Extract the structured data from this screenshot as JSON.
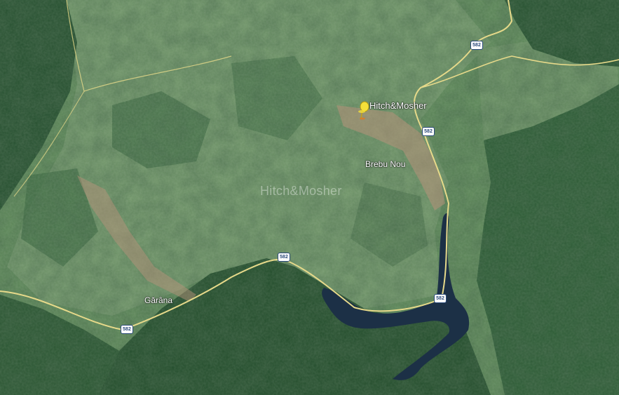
{
  "map": {
    "type": "satellite",
    "colors": {
      "forest": "#224d2c",
      "pasture": "#5f8a5a",
      "light_pasture": "#7f9f78",
      "lake": "#1c3046",
      "road": "#e6d98a",
      "village": "#b6927a",
      "pin": "#f4e03a"
    },
    "pin": {
      "label": "Hitch&Mosher",
      "icon": "yellow-pushpin-icon"
    },
    "watermark": "Hitch&Mosher",
    "places": [
      {
        "name": "Brebu Nou"
      },
      {
        "name": "Gărâna"
      }
    ],
    "road_shields": [
      "582",
      "582",
      "582",
      "582",
      "582"
    ]
  }
}
